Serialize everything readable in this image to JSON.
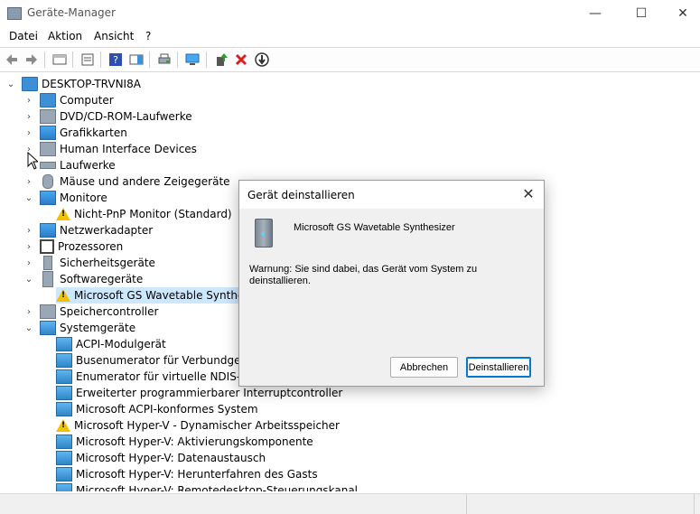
{
  "window": {
    "title": "Geräte-Manager",
    "minimize": "—",
    "maximize": "☐",
    "close": "✕"
  },
  "menu": [
    "Datei",
    "Aktion",
    "Ansicht",
    "?"
  ],
  "toolbar": {
    "icons": [
      "back-icon",
      "forward-icon",
      "properties-icon",
      "help-icon",
      "scan-icon",
      "update-driver-icon",
      "uninstall-icon",
      "disable-icon"
    ]
  },
  "tree": {
    "root": "DESKTOP-TRVNI8A",
    "items": [
      {
        "label": "Computer",
        "expanded": false
      },
      {
        "label": "DVD/CD-ROM-Laufwerke",
        "expanded": false
      },
      {
        "label": "Grafikkarten",
        "expanded": false
      },
      {
        "label": "Human Interface Devices",
        "expanded": false
      },
      {
        "label": "Laufwerke",
        "expanded": false
      },
      {
        "label": "Mäuse und andere Zeigegeräte",
        "expanded": false
      },
      {
        "label": "Monitore",
        "expanded": true
      },
      {
        "label": "Nicht-PnP Monitor (Standard)",
        "child": true,
        "warn": true
      },
      {
        "label": "Netzwerkadapter",
        "expanded": false
      },
      {
        "label": "Prozessoren",
        "expanded": false
      },
      {
        "label": "Sicherheitsgeräte",
        "expanded": false
      },
      {
        "label": "Softwaregeräte",
        "expanded": true
      },
      {
        "label": "Microsoft GS Wavetable Synthesizer",
        "child": true,
        "warn": true,
        "selected": true
      },
      {
        "label": "Speichercontroller",
        "expanded": false
      },
      {
        "label": "Systemgeräte",
        "expanded": true
      },
      {
        "label": "ACPI-Modulgerät",
        "child": true
      },
      {
        "label": "Busenumerator für Verbundgeräte",
        "child": true
      },
      {
        "label": "Enumerator für virtuelle NDIS-Netzwerkadapter",
        "child": true
      },
      {
        "label": "Erweiterter programmierbarer Interruptcontroller",
        "child": true
      },
      {
        "label": "Microsoft ACPI-konformes System",
        "child": true
      },
      {
        "label": "Microsoft Hyper-V - Dynamischer Arbeitsspeicher",
        "child": true,
        "warn": true
      },
      {
        "label": "Microsoft Hyper-V: Aktivierungskomponente",
        "child": true
      },
      {
        "label": "Microsoft Hyper-V: Datenaustausch",
        "child": true
      },
      {
        "label": "Microsoft Hyper-V: Herunterfahren des Gasts",
        "child": true
      },
      {
        "label": "Microsoft Hyper-V: Remotedesktop-Steuerungskanal",
        "child": true
      }
    ]
  },
  "dialog": {
    "title": "Gerät deinstallieren",
    "device": "Microsoft GS Wavetable Synthesizer",
    "warning": "Warnung: Sie sind dabei, das Gerät vom System zu deinstallieren.",
    "cancel": "Abbrechen",
    "uninstall": "Deinstallieren",
    "close": "✕"
  }
}
